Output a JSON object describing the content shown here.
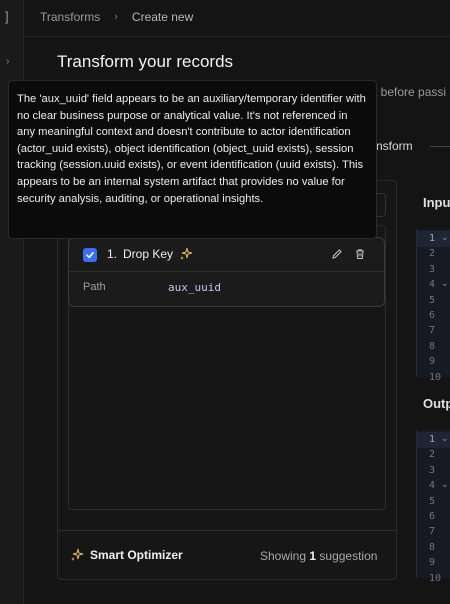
{
  "nav": {
    "bracket": "]",
    "collapse_arrow": "›"
  },
  "breadcrumb": {
    "parent": "Transforms",
    "separator": "›",
    "current": "Create new"
  },
  "page": {
    "title": "Transform your records"
  },
  "background_fragments": {
    "text1": "t before passi",
    "text2": "nsform"
  },
  "card": {
    "index": "1.",
    "name": "Drop Key",
    "path_label": "Path",
    "path_value": "aux_uuid"
  },
  "footer": {
    "optimizer_label": "Smart Optimizer",
    "showing_prefix": "Showing",
    "showing_count": "1",
    "showing_suffix": "suggestion"
  },
  "input_panel": {
    "label": "Inpu",
    "lines": [
      "1",
      "2",
      "3",
      "4",
      "5",
      "6",
      "7",
      "8",
      "9",
      "10"
    ]
  },
  "output_panel": {
    "label": "Outp",
    "lines": [
      "1",
      "2",
      "3",
      "4",
      "5",
      "6",
      "7",
      "8",
      "9",
      "10"
    ]
  },
  "tooltip": {
    "text": "The 'aux_uuid' field appears to be an auxiliary/temporary identifier with no clear business purpose or analytical value. It's not referenced in any meaningful context and doesn't contribute to actor identification (actor_uuid exists), object identification (object_uuid exists), session tracking (session.uuid exists), or event identification (uuid exists). This appears to be an internal system artifact that provides no value for security analysis, auditing, or operational insights."
  },
  "colors": {
    "accent": "#3a6df0",
    "sparkle": "#e2b86a",
    "background": "#141414"
  },
  "icons": {
    "check": "check-icon",
    "sparkle": "sparkle-icon",
    "edit": "pencil-icon",
    "delete": "trash-icon"
  }
}
